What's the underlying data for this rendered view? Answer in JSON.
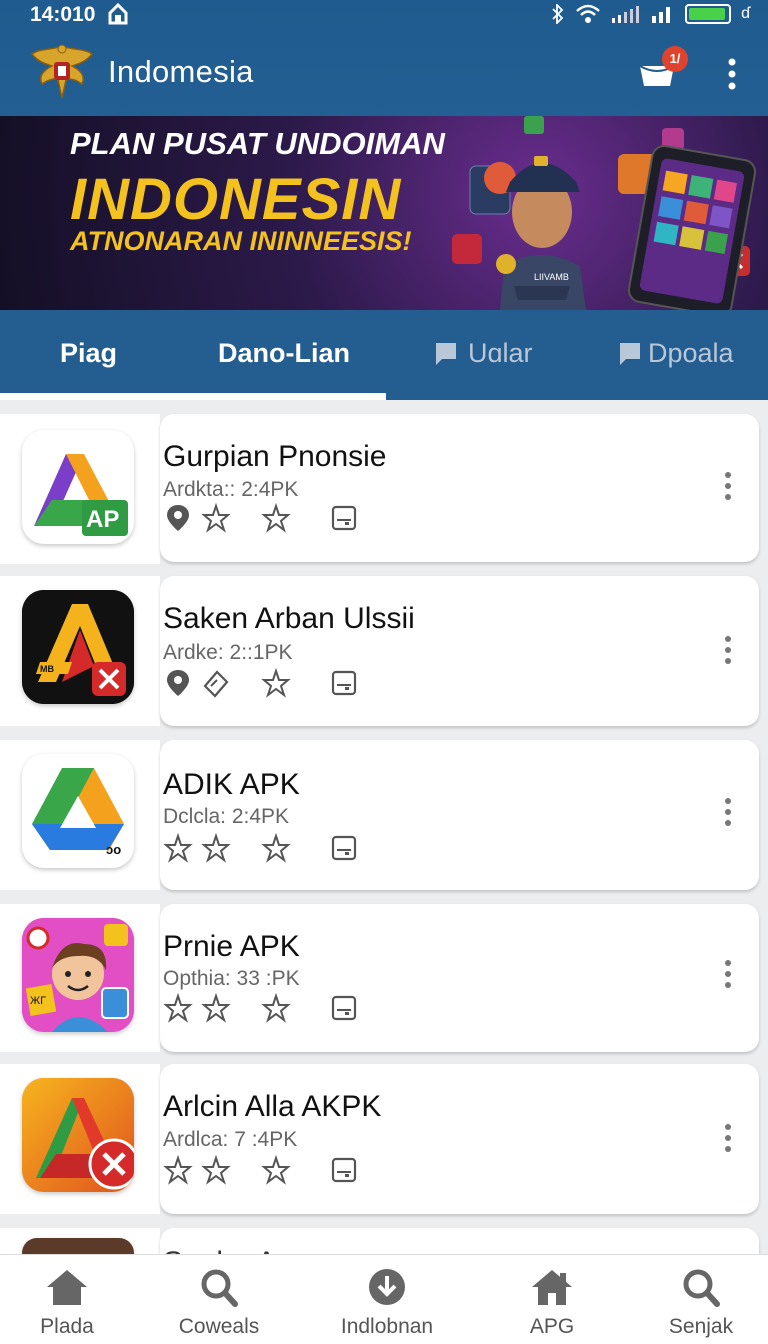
{
  "status_bar": {
    "time": "14:010",
    "battery_color": "#49d14a"
  },
  "app_bar": {
    "title": "Indomesia",
    "notification_badge": "1/"
  },
  "banner": {
    "line1": "PLAN PUSAT UNDOIMAN",
    "line2": "INDONESIN",
    "line3": "ATNONARAN ININNEESIS!",
    "badge_text": "LIIVAMB",
    "accent_color": "#f3c21f"
  },
  "tabs": [
    {
      "label": "Piag",
      "active": false
    },
    {
      "label": "Dano-Lian",
      "active": true
    },
    {
      "label": "Uɑlar",
      "active": false
    },
    {
      "label": "Dpoala",
      "active": false
    }
  ],
  "apps": [
    {
      "name": "Gurpian Pnonsie",
      "sub": "Ardkta:: 2:4PK",
      "icon_label": "AP",
      "meta_icons": [
        "location-icon",
        "star-icon",
        "star-outline-icon",
        "save-icon"
      ]
    },
    {
      "name": "Saken Arban Ulssii",
      "sub": "Ardke: 2::1PK",
      "icon_label": "MB",
      "meta_icons": [
        "location-icon",
        "tag-icon",
        "star-outline-icon",
        "save-icon"
      ]
    },
    {
      "name": "ADIK APK",
      "sub": "Dclcla: 2:4PK",
      "icon_label": "ɔo",
      "meta_icons": [
        "star-icon",
        "star-icon",
        "star-outline-icon",
        "save-icon"
      ]
    },
    {
      "name": "Prnie APK",
      "sub": "Opthia: 33 :PK",
      "icon_label": "ЖГ",
      "meta_icons": [
        "star-icon",
        "star-icon",
        "star-outline-icon",
        "save-icon"
      ]
    },
    {
      "name": "Arlcin Alla AKPK",
      "sub": "Ardlca: 7 :4PK",
      "icon_label": "",
      "meta_icons": [
        "star-icon",
        "star-icon",
        "star-outline-icon",
        "save-icon"
      ]
    },
    {
      "name": "Saelru Aran",
      "sub": "",
      "icon_label": "",
      "meta_icons": []
    }
  ],
  "bottom_nav": [
    {
      "label": "Plada",
      "icon": "home-icon"
    },
    {
      "label": "Coweals",
      "icon": "search-icon"
    },
    {
      "label": "Indlobnan",
      "icon": "download-icon"
    },
    {
      "label": "APG",
      "icon": "home-alt-icon"
    },
    {
      "label": "Senjak",
      "icon": "search-icon"
    }
  ]
}
